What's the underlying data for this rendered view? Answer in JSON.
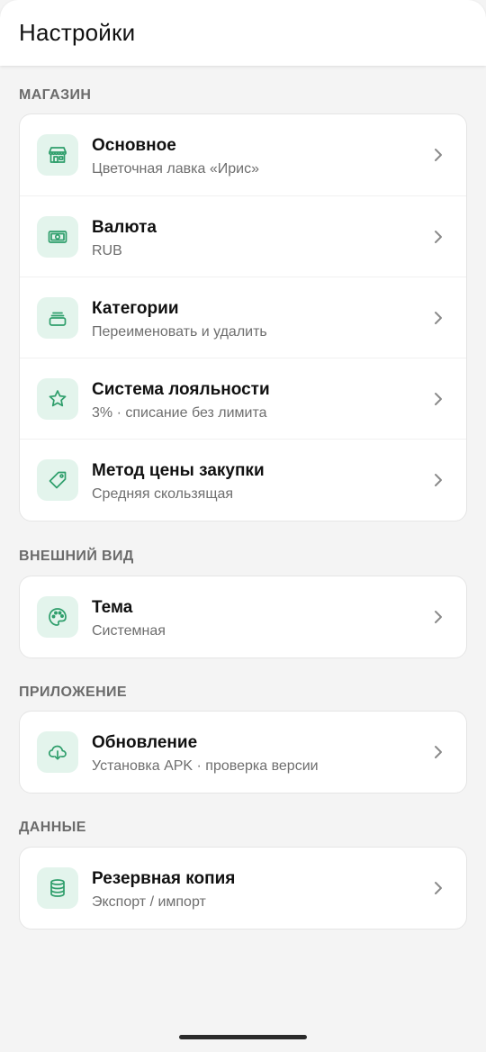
{
  "header": {
    "title": "Настройки"
  },
  "sections": [
    {
      "title": "МАГАЗИН",
      "items": [
        {
          "title": "Основное",
          "subtitle": "Цветочная лавка «Ирис»",
          "icon": "store-icon"
        },
        {
          "title": "Валюта",
          "subtitle": "RUB",
          "icon": "banknote-icon"
        },
        {
          "title": "Категории",
          "subtitle": "Переименовать и удалить",
          "icon": "folder-icon"
        },
        {
          "title": "Система лояльности",
          "subtitle": "3% · списание без лимита",
          "icon": "star-icon"
        },
        {
          "title": "Метод цены закупки",
          "subtitle": "Средняя скользящая",
          "icon": "tag-icon"
        }
      ]
    },
    {
      "title": "ВНЕШНИЙ ВИД",
      "items": [
        {
          "title": "Тема",
          "subtitle": "Системная",
          "icon": "palette-icon"
        }
      ]
    },
    {
      "title": "ПРИЛОЖЕНИЕ",
      "items": [
        {
          "title": "Обновление",
          "subtitle": "Установка APK · проверка версии",
          "icon": "cloud-download-icon"
        }
      ]
    },
    {
      "title": "ДАННЫЕ",
      "items": [
        {
          "title": "Резервная копия",
          "subtitle": "Экспорт / импорт",
          "icon": "database-icon"
        }
      ]
    }
  ],
  "colors": {
    "accent": "#2e9e6b",
    "icon_bg": "#e3f4ec",
    "background": "#f4f4f4"
  }
}
